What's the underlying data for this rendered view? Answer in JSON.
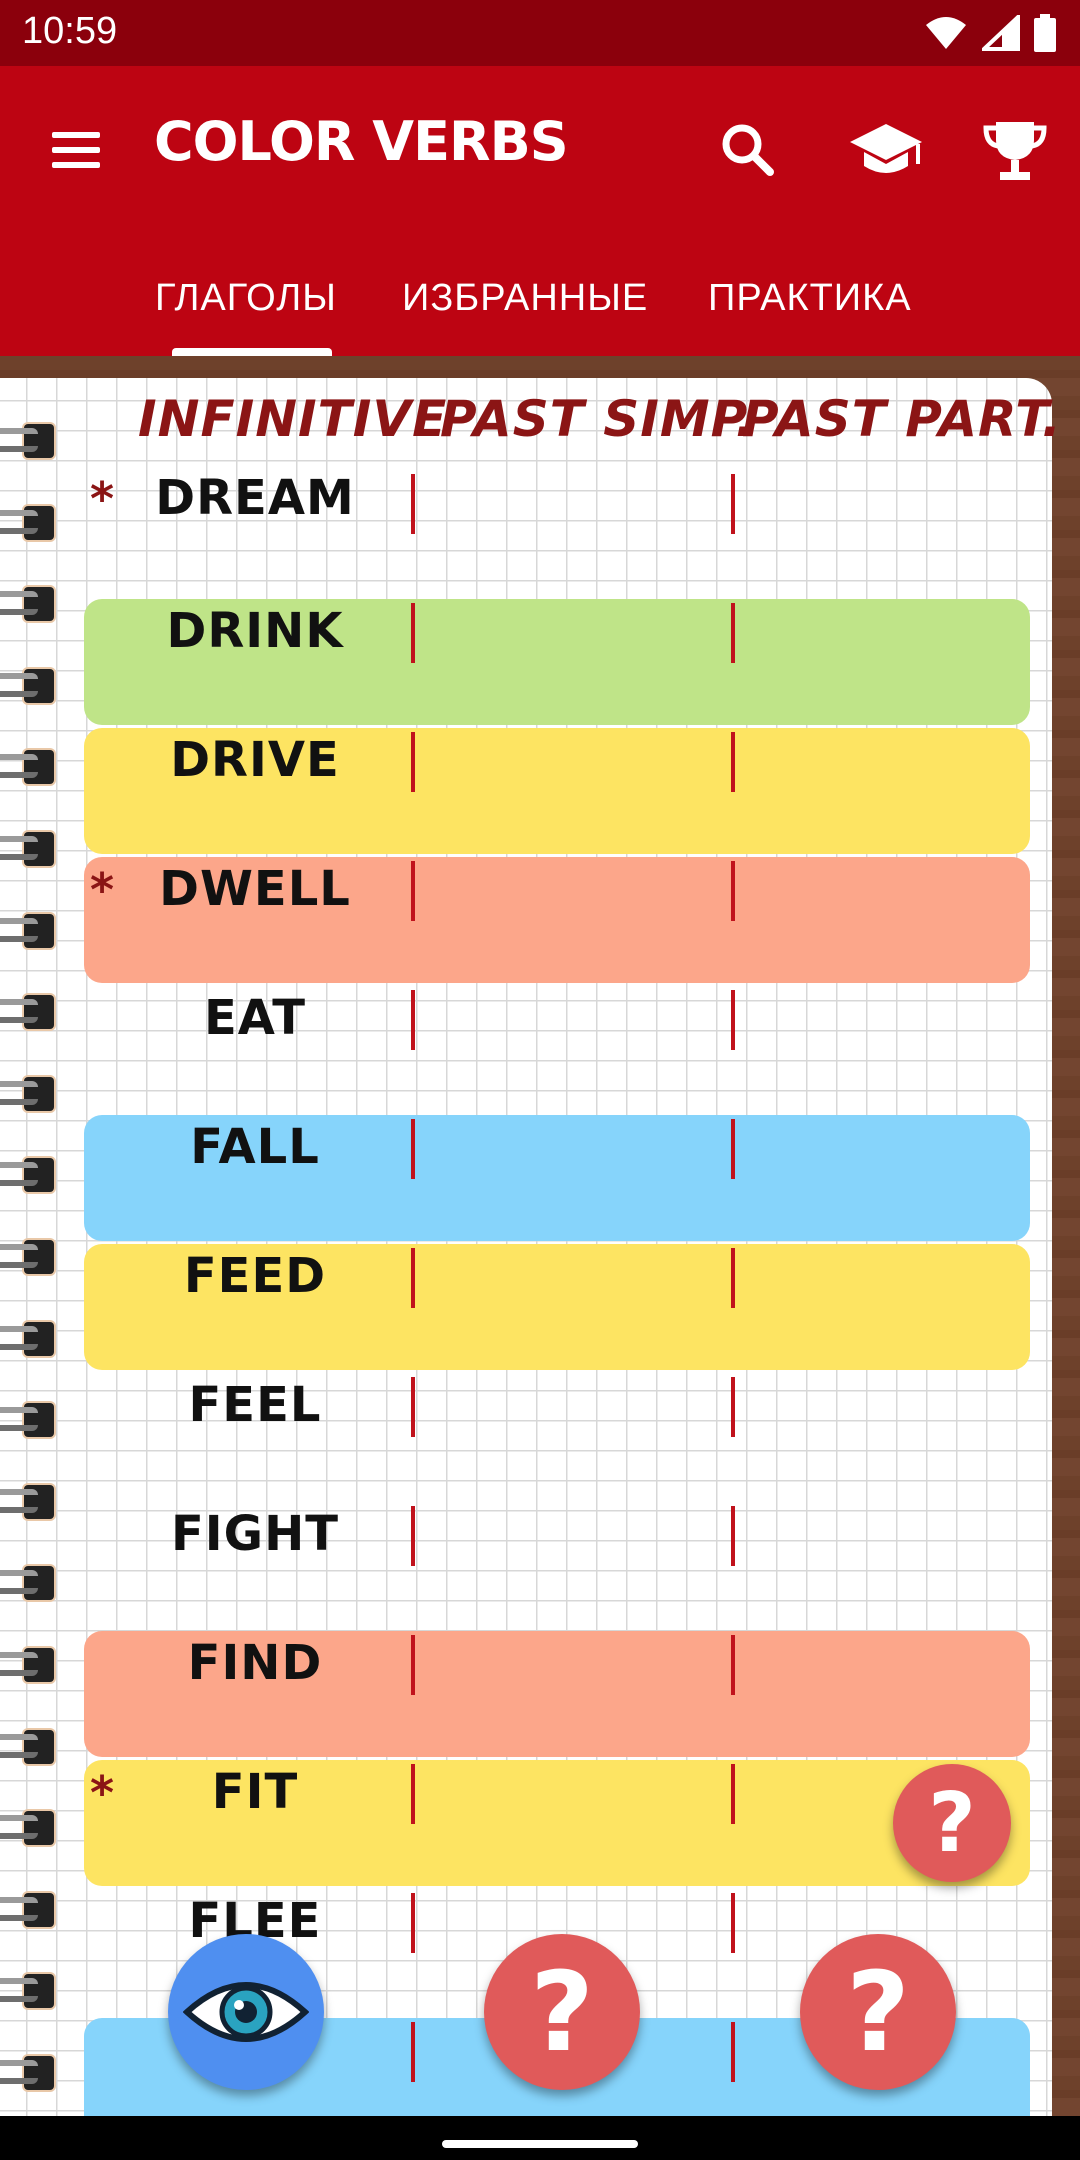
{
  "status_bar": {
    "time": "10:59",
    "icons": [
      "wifi-icon",
      "signal-icon",
      "battery-icon"
    ]
  },
  "app_bar": {
    "title": "COLOR VERBS",
    "actions": [
      "search-icon",
      "school-icon",
      "trophy-icon"
    ]
  },
  "tabs": [
    {
      "label": "ГЛАГОЛЫ",
      "selected": true
    },
    {
      "label": "ИЗБРАННЫЕ",
      "selected": false
    },
    {
      "label": "ПРАКТИКА",
      "selected": false
    }
  ],
  "table": {
    "headers": {
      "infinitive": "INFINITIVE",
      "past_simple": "PAST SIMP.",
      "past_participle": "PAST PART."
    },
    "rows": [
      {
        "verb": "DREAM",
        "starred": true,
        "color": "none"
      },
      {
        "verb": "DRINK",
        "starred": false,
        "color": "#bfe488"
      },
      {
        "verb": "DRIVE",
        "starred": false,
        "color": "#fde462"
      },
      {
        "verb": "DWELL",
        "starred": true,
        "color": "#fca68a"
      },
      {
        "verb": "EAT",
        "starred": false,
        "color": "none"
      },
      {
        "verb": "FALL",
        "starred": false,
        "color": "#86d4fb"
      },
      {
        "verb": "FEED",
        "starred": false,
        "color": "#fde462"
      },
      {
        "verb": "FEEL",
        "starred": false,
        "color": "none"
      },
      {
        "verb": "FIGHT",
        "starred": false,
        "color": "none"
      },
      {
        "verb": "FIND",
        "starred": false,
        "color": "#fca68a"
      },
      {
        "verb": "FIT",
        "starred": true,
        "color": "#fde462"
      },
      {
        "verb": "FLEE",
        "starred": false,
        "color": "none"
      },
      {
        "verb": "",
        "starred": false,
        "color": "#86d4fb"
      }
    ],
    "star_symbol": "*"
  },
  "fabs": {
    "hint": "?",
    "show_icon": "eye-icon"
  },
  "colors": {
    "primary": "#bd0412",
    "status_bar": "#8b000c",
    "header_text": "#8b1515",
    "divider_tick": "#c0121c",
    "fab_red": "#e05a5a",
    "fab_blue": "#4f8ff0"
  }
}
